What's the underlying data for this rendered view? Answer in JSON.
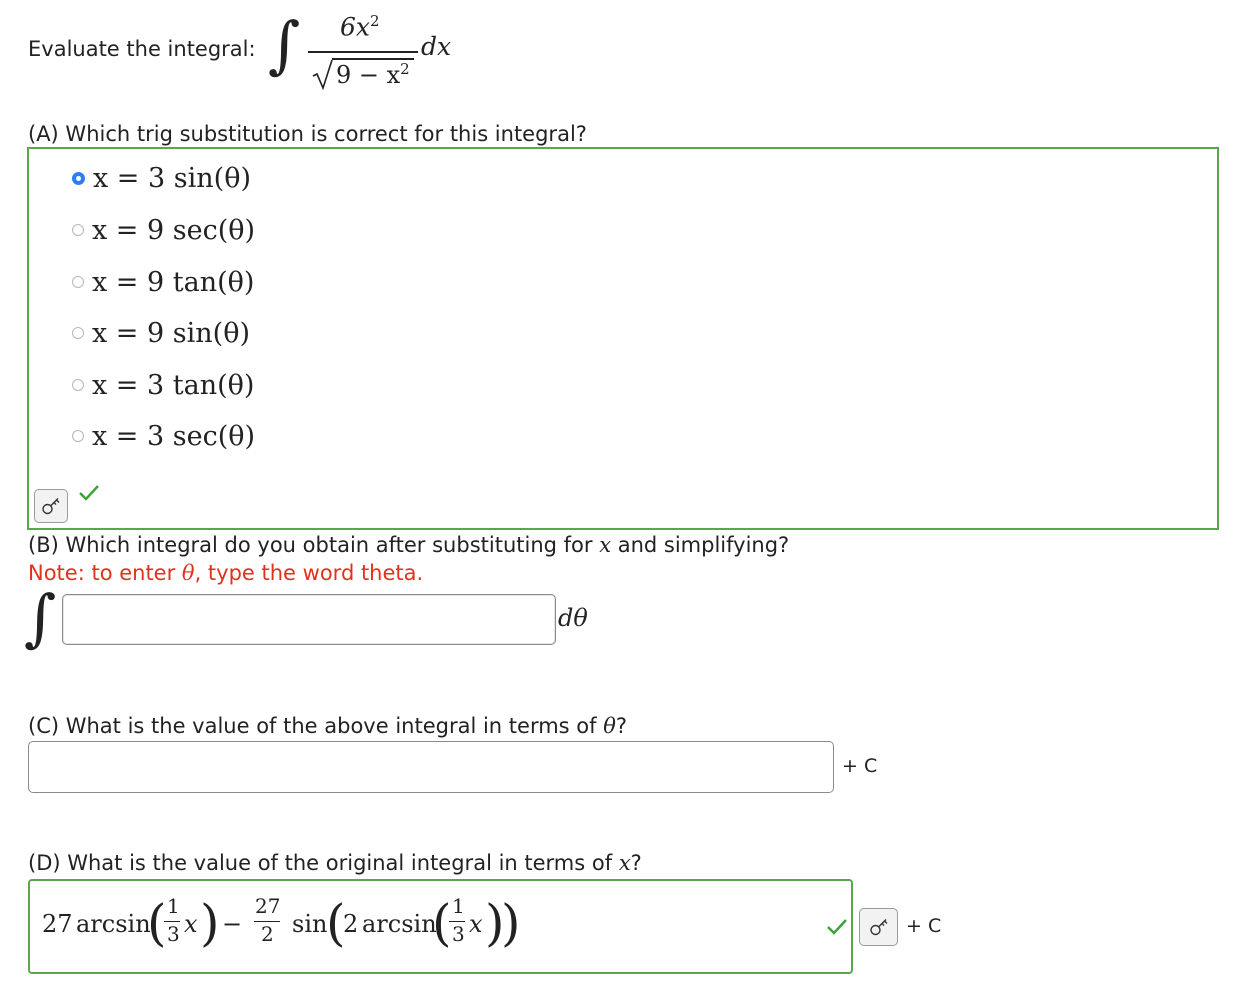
{
  "header": {
    "prompt": "Evaluate the integral:",
    "integrand_numerator": "6x",
    "integrand_numerator_exp": "2",
    "integrand_denominator": "9 − x",
    "integrand_denominator_exp": "2",
    "differential": "dx"
  },
  "partA": {
    "question": "(A) Which trig substitution is correct for this integral?",
    "options": [
      {
        "label": "x = 3 sin(θ)",
        "selected": true
      },
      {
        "label": "x = 9 sec(θ)",
        "selected": false
      },
      {
        "label": "x = 9 tan(θ)",
        "selected": false
      },
      {
        "label": "x = 9 sin(θ)",
        "selected": false
      },
      {
        "label": "x = 3 tan(θ)",
        "selected": false
      },
      {
        "label": "x = 3 sec(θ)",
        "selected": false
      }
    ],
    "status": "correct",
    "key_icon": "key-icon",
    "check_icon": "checkmark-icon"
  },
  "partB": {
    "question_prefix": "(B) Which integral do you obtain after substituting for ",
    "question_var": "x",
    "question_suffix": " and simplifying?",
    "note_prefix": "Note: to enter ",
    "note_symbol": "θ",
    "note_suffix": ", type the word theta.",
    "input_value": "",
    "differential": "dθ"
  },
  "partC": {
    "question_prefix": "(C) What is the value of the above integral in terms of ",
    "question_var": "θ",
    "question_suffix": "?",
    "input_value": "",
    "plus_c": "+ C"
  },
  "partD": {
    "question_prefix": "(D) What is the value of the original integral in terms of ",
    "question_var": "x",
    "question_suffix": "?",
    "answer": {
      "coef1": "27",
      "fn1": "arcsin",
      "frac1_num": "1",
      "frac1_den": "3",
      "var1": "x",
      "minus": "−",
      "frac2_num": "27",
      "frac2_den": "2",
      "fn2": "sin",
      "coef2": "2",
      "fn3": "arcsin",
      "frac3_num": "1",
      "frac3_den": "3",
      "var3": "x"
    },
    "plus_c": "+ C",
    "status": "correct"
  },
  "colors": {
    "correct_green": "#3aa335",
    "box_green": "#5aa64c",
    "note_red": "#e0321d",
    "radio_blue": "#2d7ff9"
  }
}
